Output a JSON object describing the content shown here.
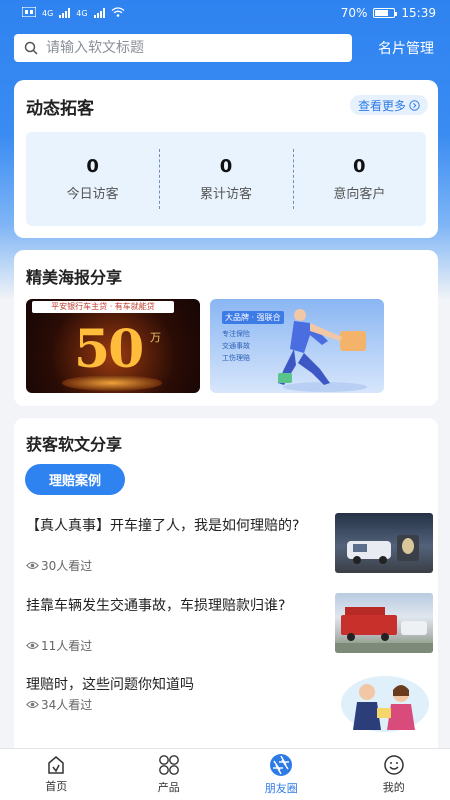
{
  "statusbar": {
    "network": "4G",
    "network2": "4G",
    "battery": "70%",
    "battery_level": 0.7,
    "time": "15:39"
  },
  "search": {
    "placeholder": "请输入软文标题"
  },
  "header": {
    "card_management": "名片管理"
  },
  "visitors": {
    "title": "动态拓客",
    "more_label": "查看更多",
    "stats": [
      {
        "value": "0",
        "label": "今日访客"
      },
      {
        "value": "0",
        "label": "累计访客"
      },
      {
        "value": "0",
        "label": "意向客户"
      }
    ]
  },
  "posters": {
    "title": "精美海报分享",
    "items": [
      {
        "ribbon": "平安银行车主贷 · 有车就能贷",
        "number": "50",
        "unit": "万"
      },
      {
        "tag": "大品牌 · 强联合",
        "bullets": [
          "专注保险",
          "交通事故",
          "工伤理赔"
        ]
      }
    ]
  },
  "articles": {
    "title": "获客软文分享",
    "category": "理赔案例",
    "items": [
      {
        "title": "【真人真事】开车撞了人，我是如何理赔的?",
        "views": "30人看过"
      },
      {
        "title": "挂靠车辆发生交通事故，车损理赔款归谁?",
        "views": "11人看过"
      },
      {
        "title": "理赔时，这些问题你知道吗",
        "views": "34人看过"
      }
    ]
  },
  "nav": {
    "items": [
      {
        "label": "首页",
        "icon": "home-icon"
      },
      {
        "label": "产品",
        "icon": "grid-icon"
      },
      {
        "label": "朋友圈",
        "icon": "aperture-icon",
        "active": true
      },
      {
        "label": "我的",
        "icon": "profile-icon"
      }
    ]
  },
  "colors": {
    "primary": "#2f83f0",
    "link": "#2f7be6"
  }
}
